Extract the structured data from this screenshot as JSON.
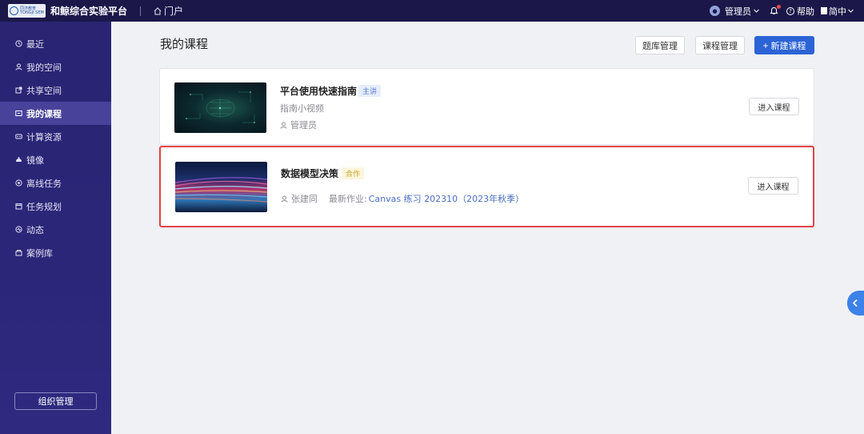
{
  "header": {
    "logo_lines": [
      "同济教育",
      "TONGJI SEM"
    ],
    "app_name": "和鲸综合实验平台",
    "portal_label": "门户",
    "admin_label": "管理员",
    "help_label": "帮助",
    "lang_label": "简中"
  },
  "sidebar": {
    "items": [
      {
        "label": "最近",
        "icon": "clock-icon"
      },
      {
        "label": "我的空间",
        "icon": "user-icon"
      },
      {
        "label": "共享空间",
        "icon": "share-icon"
      },
      {
        "label": "我的课程",
        "icon": "course-icon",
        "active": true
      },
      {
        "label": "计算资源",
        "icon": "compute-icon"
      },
      {
        "label": "镜像",
        "icon": "image-icon"
      },
      {
        "label": "离线任务",
        "icon": "task-icon"
      },
      {
        "label": "任务规划",
        "icon": "calendar-icon"
      },
      {
        "label": "动态",
        "icon": "activity-icon"
      },
      {
        "label": "案例库",
        "icon": "library-icon"
      }
    ],
    "org_button": "组织管理"
  },
  "main": {
    "title": "我的课程",
    "buttons": {
      "question_bank": "题库管理",
      "course_manage": "课程管理",
      "new_course": "新建课程"
    },
    "courses": [
      {
        "title": "平台使用快速指南",
        "tag": "主讲",
        "subtitle": "指南小视频",
        "owner": "管理员",
        "enter": "进入课程"
      },
      {
        "title": "数据模型决策",
        "tag": "合作",
        "owner": "张建同",
        "homework_label": "最新作业:",
        "homework_link": "Canvas 练习 202310（2023年秋季）",
        "enter": "进入课程"
      }
    ]
  },
  "colors": {
    "topbar": "#1b1749",
    "sidebar": "#2a2473",
    "primary": "#2c64d6",
    "highlight": "#e04545"
  }
}
